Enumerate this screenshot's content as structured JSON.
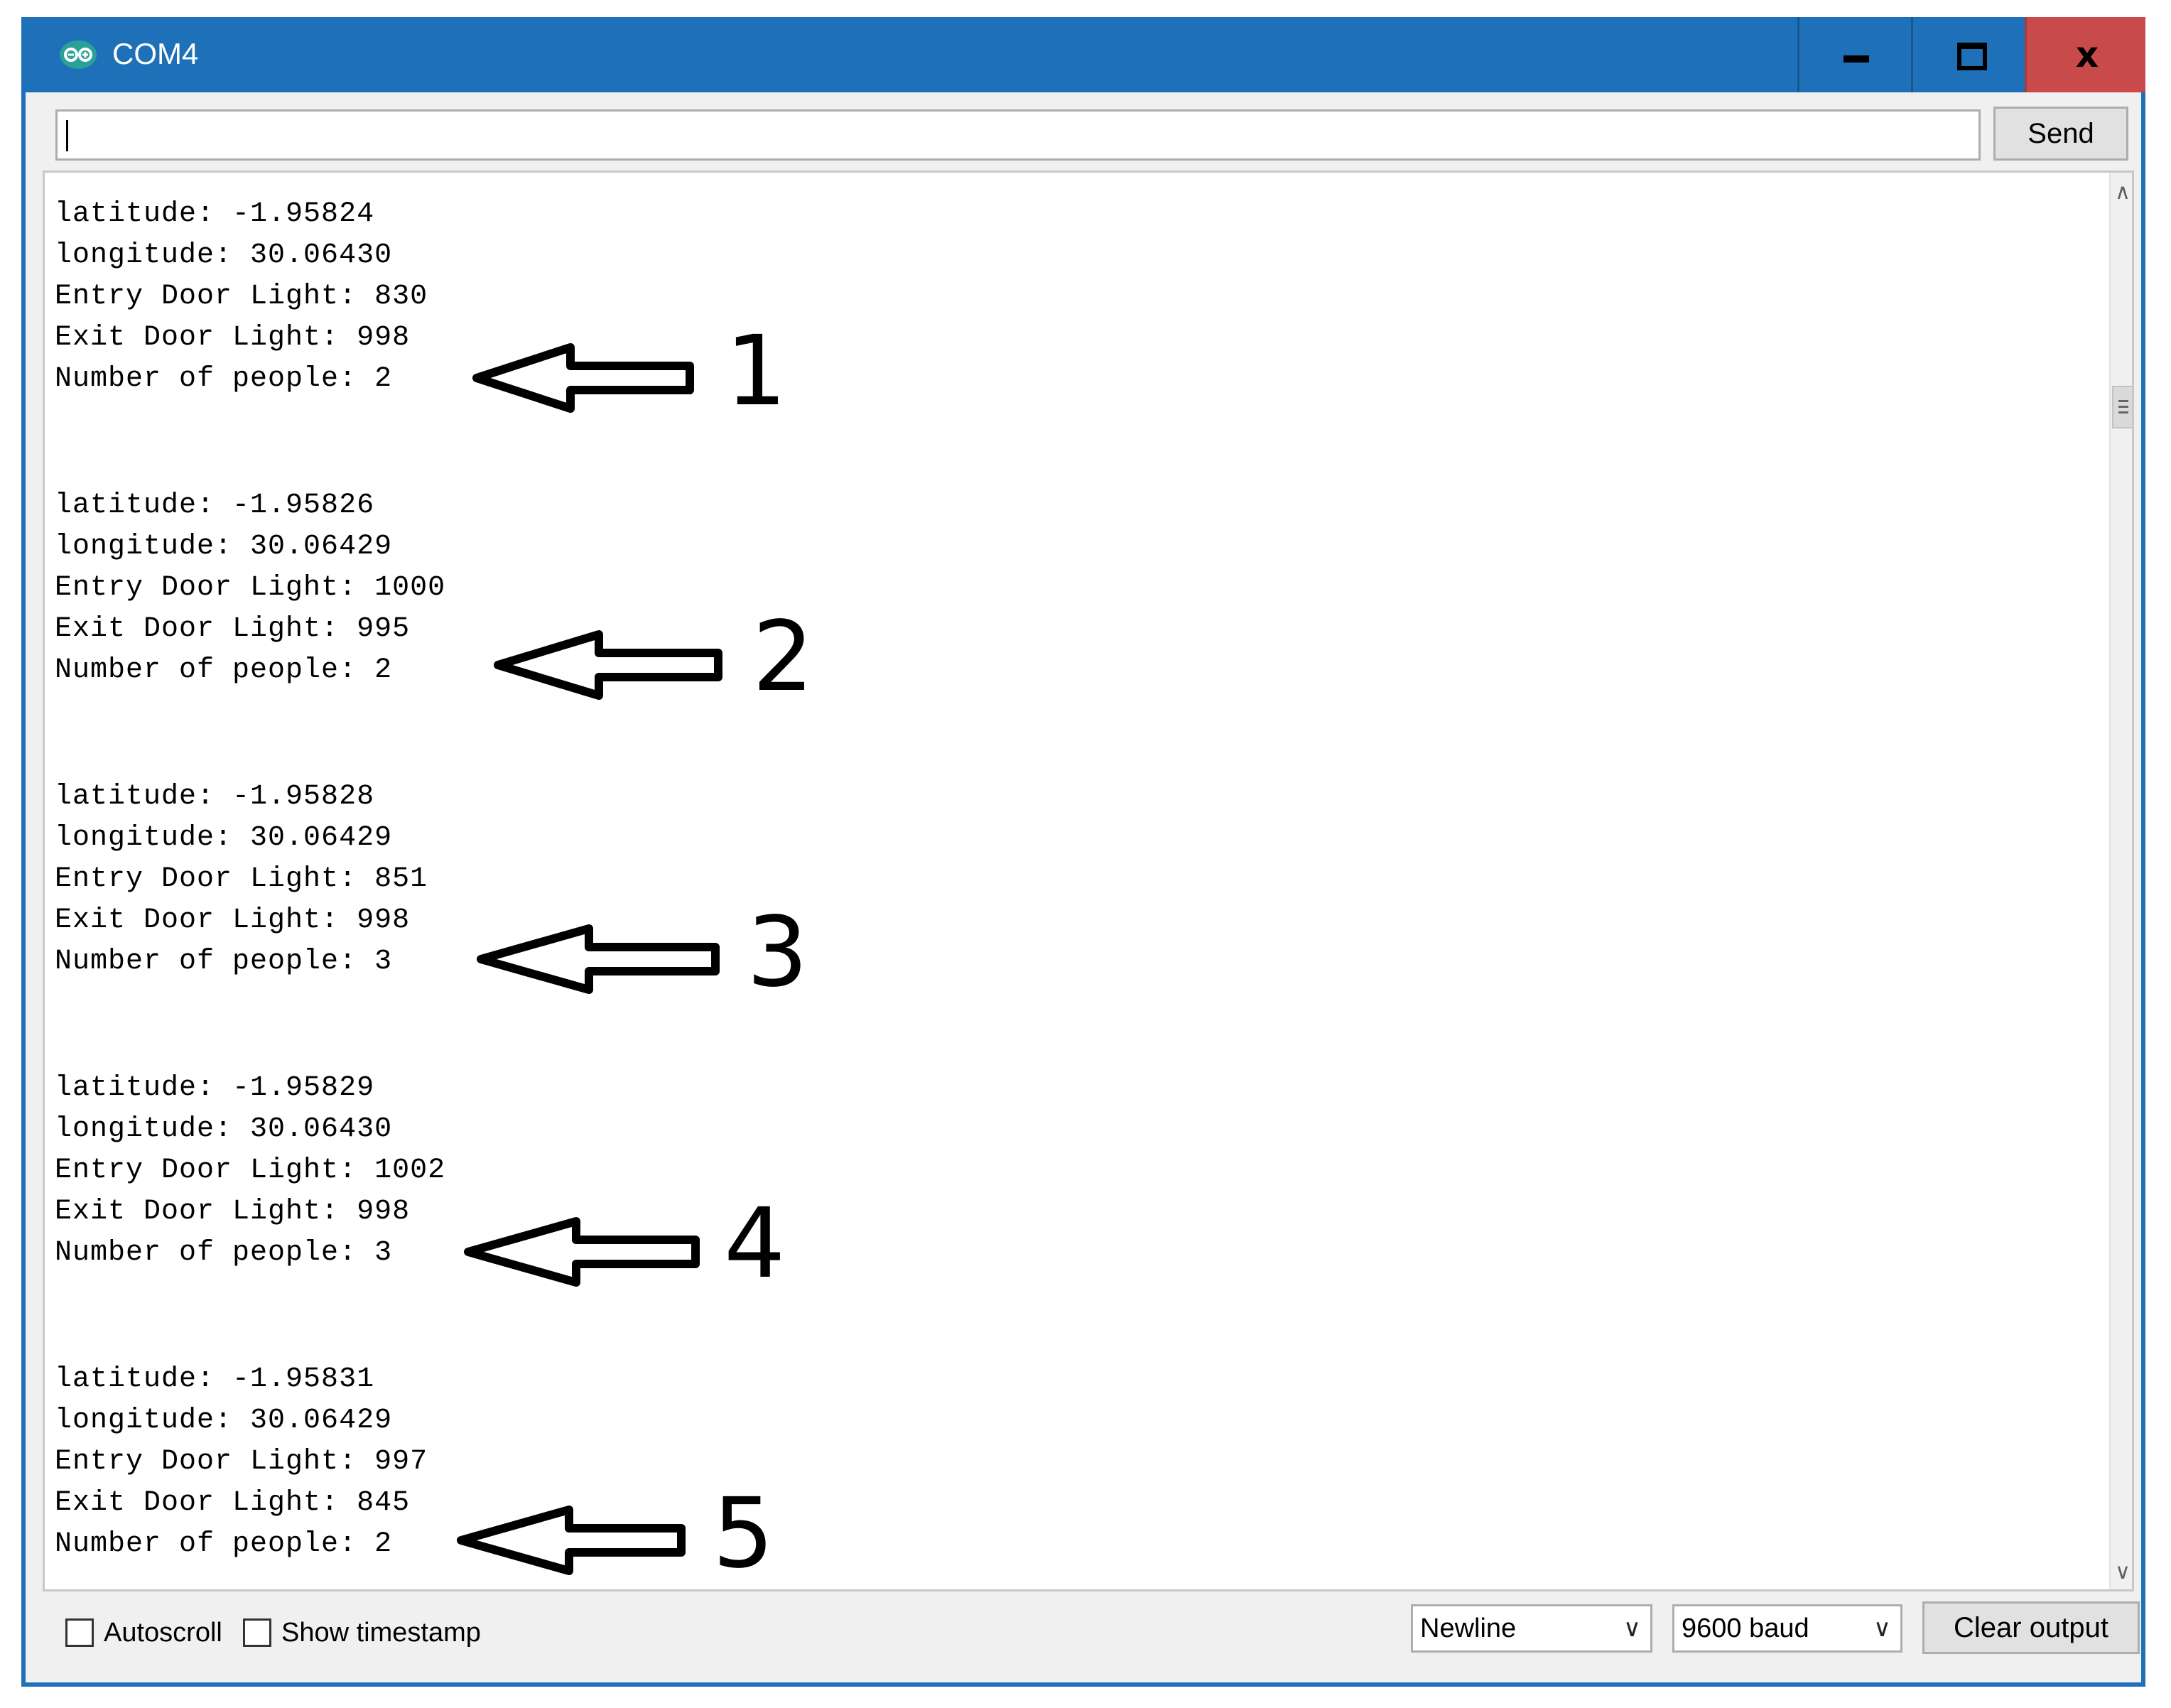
{
  "window": {
    "title": "COM4",
    "controls": {
      "minimize": "minimize",
      "maximize": "maximize",
      "close": "x"
    }
  },
  "input": {
    "value": "",
    "send_label": "Send"
  },
  "log": [
    {
      "latitude": "latitude: -1.95824",
      "longitude": "longitude: 30.06430",
      "entry": "Entry Door Light: 830",
      "exit": "Exit Door Light: 998",
      "people": "Number of people: 2",
      "marker": "1"
    },
    {
      "latitude": "latitude: -1.95826",
      "longitude": "longitude: 30.06429",
      "entry": "Entry Door Light: 1000",
      "exit": "Exit Door Light: 995",
      "people": "Number of people: 2",
      "marker": "2"
    },
    {
      "latitude": "latitude: -1.95828",
      "longitude": "longitude: 30.06429",
      "entry": "Entry Door Light: 851",
      "exit": "Exit Door Light: 998",
      "people": "Number of people: 3",
      "marker": "3"
    },
    {
      "latitude": "latitude: -1.95829",
      "longitude": "longitude: 30.06430",
      "entry": "Entry Door Light: 1002",
      "exit": "Exit Door Light: 998",
      "people": "Number of people: 3",
      "marker": "4"
    },
    {
      "latitude": "latitude: -1.95831",
      "longitude": "longitude: 30.06429",
      "entry": "Entry Door Light: 997",
      "exit": "Exit Door Light: 845",
      "people": "Number of people: 2",
      "marker": "5"
    }
  ],
  "footer": {
    "autoscroll_label": "Autoscroll",
    "autoscroll_checked": false,
    "timestamp_label": "Show timestamp",
    "timestamp_checked": false,
    "line_ending": "Newline",
    "baud_rate": "9600 baud",
    "clear_label": "Clear output"
  },
  "colors": {
    "titlebar": "#1e71b8",
    "close_button": "#c94a4a",
    "panel": "#f0f0f0"
  }
}
